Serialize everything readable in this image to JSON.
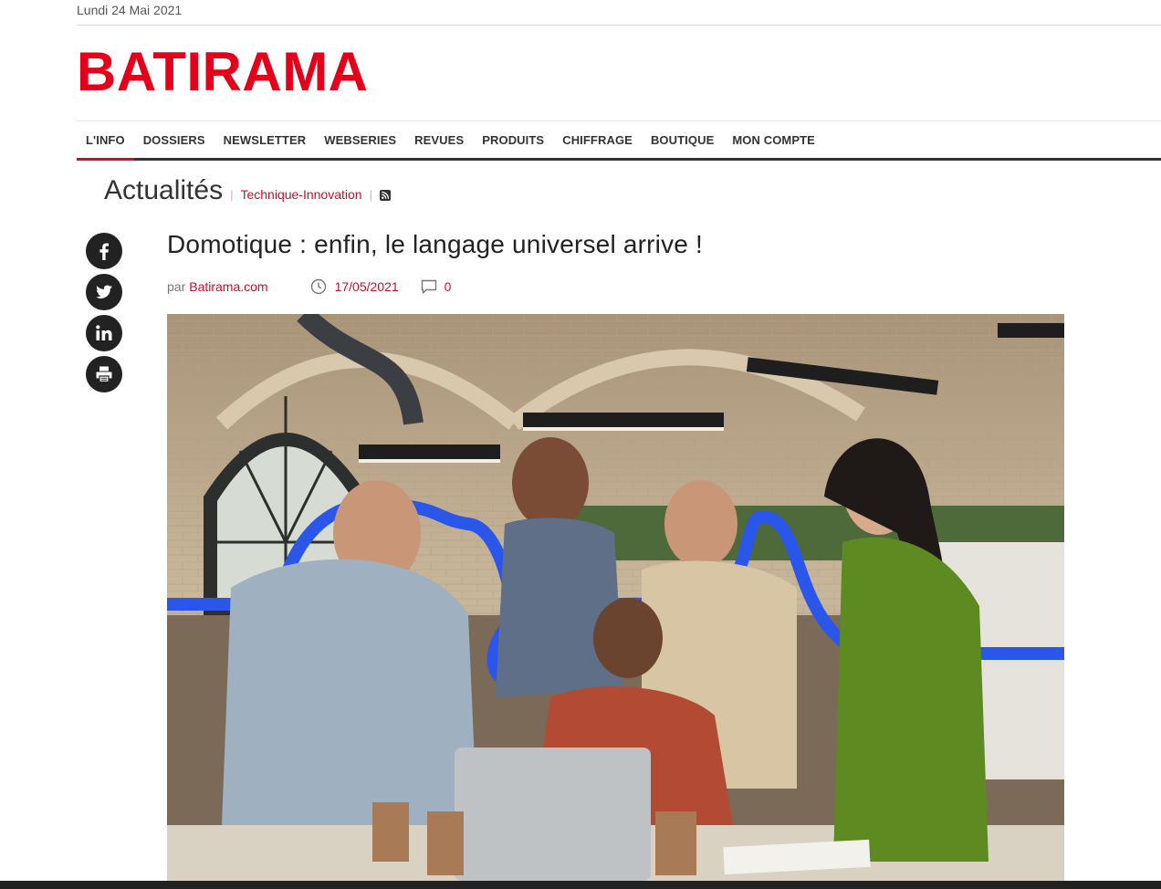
{
  "header": {
    "date": "Lundi 24 Mai 2021",
    "logo": "BATIRAMA"
  },
  "nav": {
    "items": [
      {
        "label": "L'INFO",
        "active": true
      },
      {
        "label": "DOSSIERS"
      },
      {
        "label": "NEWSLETTER"
      },
      {
        "label": "WEBSERIES"
      },
      {
        "label": "REVUES"
      },
      {
        "label": "PRODUITS"
      },
      {
        "label": "CHIFFRAGE"
      },
      {
        "label": "BOUTIQUE"
      },
      {
        "label": "MON COMPTE"
      }
    ]
  },
  "section": {
    "title": "Actualités",
    "category": "Technique-Innovation",
    "rss_icon": "rss-icon"
  },
  "share": {
    "icons": [
      "facebook-icon",
      "twitter-icon",
      "linkedin-icon",
      "print-icon"
    ]
  },
  "article": {
    "title": "Domotique : enfin, le langage universel arrive !",
    "by_prefix": "par",
    "author": "Batirama.com",
    "date": "17/05/2021",
    "comments": "0"
  },
  "colors": {
    "brand": "#e2001a",
    "link": "#c8102e",
    "text": "#222222",
    "accent_line": "#1f4fe0"
  }
}
